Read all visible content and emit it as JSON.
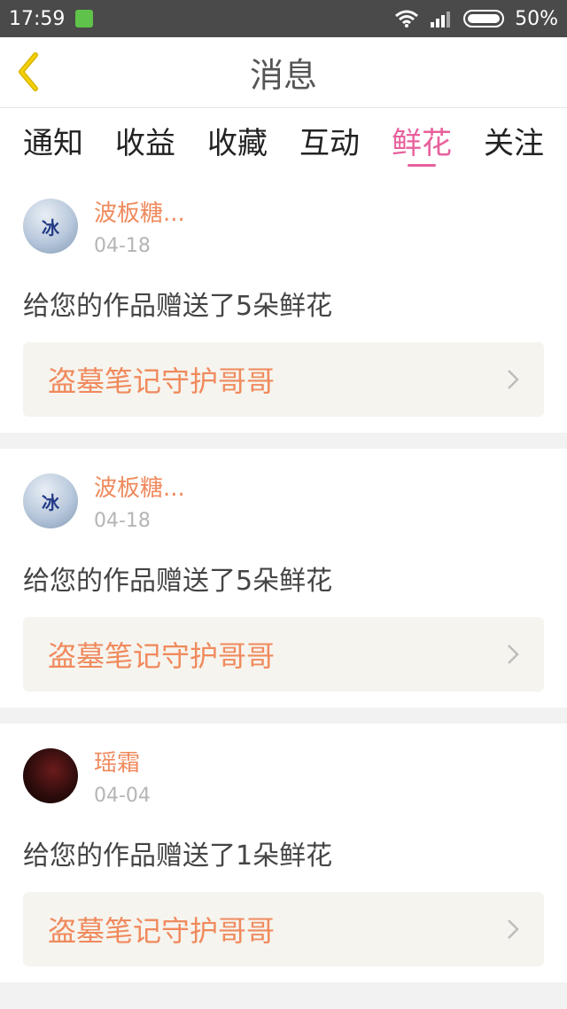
{
  "status": {
    "time": "17:59",
    "battery": "50%"
  },
  "header": {
    "title": "消息"
  },
  "tabs": [
    {
      "label": "通知"
    },
    {
      "label": "收益"
    },
    {
      "label": "收藏"
    },
    {
      "label": "互动"
    },
    {
      "label": "鲜花"
    },
    {
      "label": "关注"
    }
  ],
  "activeTab": 4,
  "items": [
    {
      "user": "波板糖...",
      "date": "04-18",
      "message": "给您的作品赠送了5朵鲜花",
      "work": "盗墓笔记守护哥哥"
    },
    {
      "user": "波板糖...",
      "date": "04-18",
      "message": "给您的作品赠送了5朵鲜花",
      "work": "盗墓笔记守护哥哥"
    },
    {
      "user": "瑶霜",
      "date": "04-04",
      "message": "给您的作品赠送了1朵鲜花",
      "work": "盗墓笔记守护哥哥"
    }
  ],
  "colors": {
    "accent_pink": "#e8609c",
    "orange": "#f08a5d"
  }
}
